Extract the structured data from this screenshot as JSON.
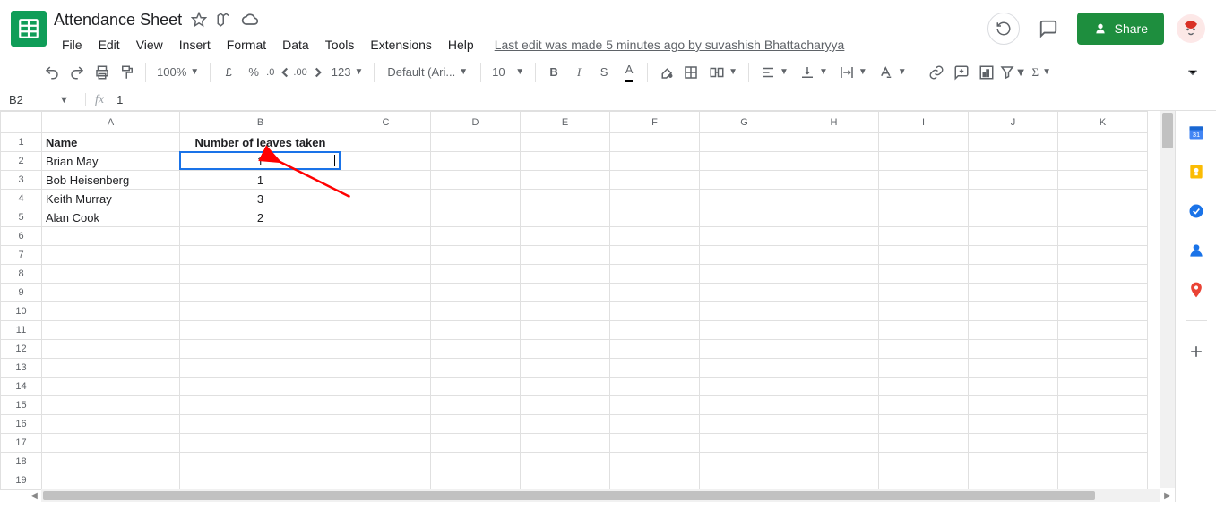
{
  "title": {
    "doc_name": "Attendance Sheet"
  },
  "menu": {
    "items": [
      "File",
      "Edit",
      "View",
      "Insert",
      "Format",
      "Data",
      "Tools",
      "Extensions",
      "Help"
    ],
    "last_edit": "Last edit was made 5 minutes ago by suvashish Bhattacharyya"
  },
  "header_actions": {
    "share_label": "Share"
  },
  "toolbar": {
    "zoom": "100%",
    "currency_symbol": "£",
    "percent": "%",
    "dec_dec": ".0",
    "inc_dec": ".00",
    "more_formats": "123",
    "font": "Default (Ari...",
    "font_size": "10",
    "bold": "B",
    "italic": "I",
    "strike": "S"
  },
  "formula_bar": {
    "cell_ref": "B2",
    "value": "1"
  },
  "sheet": {
    "columns": [
      "A",
      "B",
      "C",
      "D",
      "E",
      "F",
      "G",
      "H",
      "I",
      "J",
      "K"
    ],
    "row_count": 19,
    "headers": {
      "A": "Name",
      "B": "Number of leaves taken"
    },
    "rows": [
      {
        "A": "Brian May",
        "B": "1"
      },
      {
        "A": "Bob Heisenberg",
        "B": "1"
      },
      {
        "A": "Keith  Murray",
        "B": "3"
      },
      {
        "A": "Alan Cook",
        "B": "2"
      }
    ],
    "selection": {
      "ref": "B2"
    }
  },
  "annotation": {
    "type": "arrow",
    "color": "#ff0000"
  }
}
